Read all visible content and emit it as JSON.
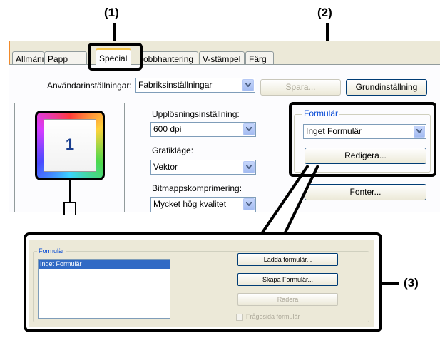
{
  "callouts": {
    "one": "(1)",
    "two": "(2)",
    "three": "(3)"
  },
  "tabs": [
    {
      "label": "Allmänna"
    },
    {
      "label": "Papp"
    },
    {
      "label": "Special"
    },
    {
      "label": "obbhantering"
    },
    {
      "label": "V-stämpel"
    },
    {
      "label": "Färg"
    }
  ],
  "user_settings": {
    "label": "Användarinställningar:",
    "value": "Fabriksinställningar",
    "save_label": "Spara...",
    "default_label": "Grundinställning"
  },
  "preview": {
    "page_number": "1"
  },
  "resolution": {
    "label": "Upplösningsinställning:",
    "value": "600 dpi"
  },
  "graphics": {
    "label": "Grafikläge:",
    "value": "Vektor"
  },
  "compression": {
    "label": "Bitmappskomprimering:",
    "value": "Mycket hög kvalitet"
  },
  "form_group": {
    "title": "Formulär",
    "value": "Inget Formulär",
    "edit_label": "Redigera..."
  },
  "fonts_label": "Fonter...",
  "dialog": {
    "group_title": "Formulär",
    "list_items": [
      "Inget Formulär"
    ],
    "load_label": "Ladda formulär...",
    "create_label": "Skapa Formulär...",
    "delete_label": "Radera",
    "query_label": "Frågesida formulär"
  }
}
